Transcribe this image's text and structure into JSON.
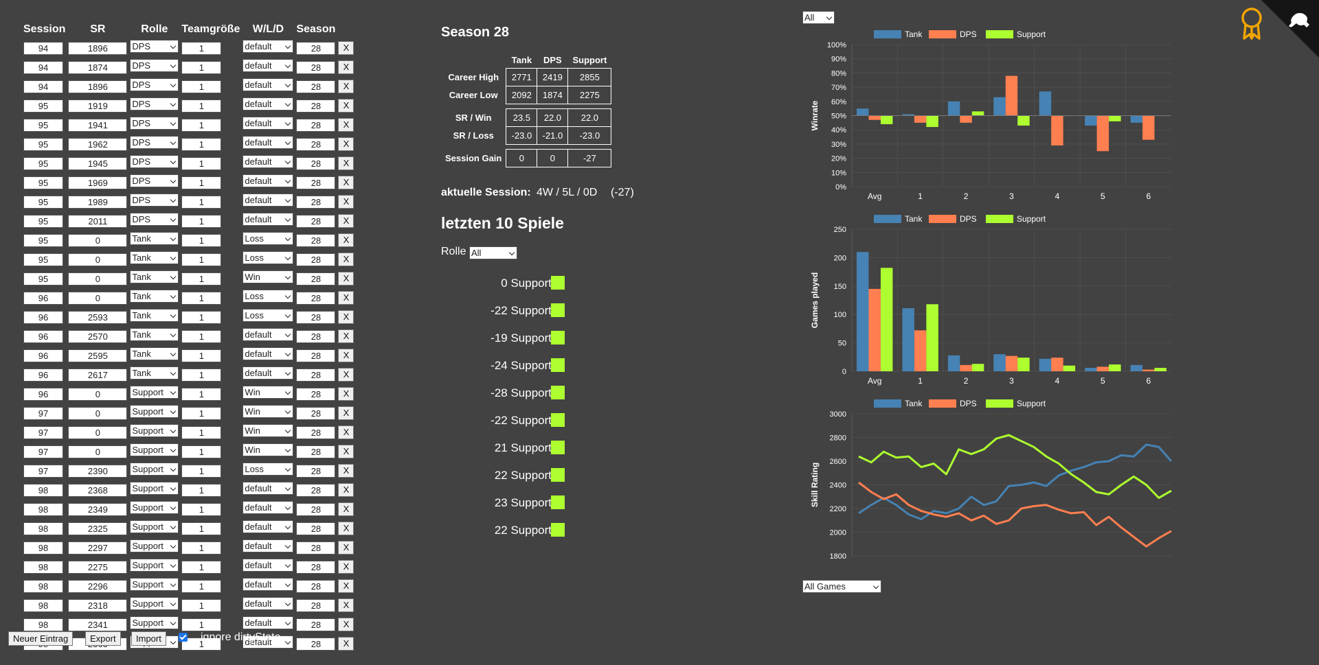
{
  "table": {
    "headers": [
      "Session",
      "SR",
      "Rolle",
      "Teamgröße",
      "W/L/D",
      "Season"
    ],
    "delete_label": "X",
    "rows": [
      {
        "session": "94",
        "sr": "1896",
        "role": "DPS",
        "team": "1",
        "wld": "default",
        "season": "28"
      },
      {
        "session": "94",
        "sr": "1874",
        "role": "DPS",
        "team": "1",
        "wld": "default",
        "season": "28"
      },
      {
        "session": "94",
        "sr": "1896",
        "role": "DPS",
        "team": "1",
        "wld": "default",
        "season": "28"
      },
      {
        "session": "95",
        "sr": "1919",
        "role": "DPS",
        "team": "1",
        "wld": "default",
        "season": "28"
      },
      {
        "session": "95",
        "sr": "1941",
        "role": "DPS",
        "team": "1",
        "wld": "default",
        "season": "28"
      },
      {
        "session": "95",
        "sr": "1962",
        "role": "DPS",
        "team": "1",
        "wld": "default",
        "season": "28"
      },
      {
        "session": "95",
        "sr": "1945",
        "role": "DPS",
        "team": "1",
        "wld": "default",
        "season": "28"
      },
      {
        "session": "95",
        "sr": "1969",
        "role": "DPS",
        "team": "1",
        "wld": "default",
        "season": "28"
      },
      {
        "session": "95",
        "sr": "1989",
        "role": "DPS",
        "team": "1",
        "wld": "default",
        "season": "28"
      },
      {
        "session": "95",
        "sr": "2011",
        "role": "DPS",
        "team": "1",
        "wld": "default",
        "season": "28"
      },
      {
        "session": "95",
        "sr": "0",
        "role": "Tank",
        "team": "1",
        "wld": "Loss",
        "season": "28"
      },
      {
        "session": "95",
        "sr": "0",
        "role": "Tank",
        "team": "1",
        "wld": "Loss",
        "season": "28"
      },
      {
        "session": "95",
        "sr": "0",
        "role": "Tank",
        "team": "1",
        "wld": "Win",
        "season": "28"
      },
      {
        "session": "96",
        "sr": "0",
        "role": "Tank",
        "team": "1",
        "wld": "Loss",
        "season": "28"
      },
      {
        "session": "96",
        "sr": "2593",
        "role": "Tank",
        "team": "1",
        "wld": "Loss",
        "season": "28"
      },
      {
        "session": "96",
        "sr": "2570",
        "role": "Tank",
        "team": "1",
        "wld": "default",
        "season": "28"
      },
      {
        "session": "96",
        "sr": "2595",
        "role": "Tank",
        "team": "1",
        "wld": "default",
        "season": "28"
      },
      {
        "session": "96",
        "sr": "2617",
        "role": "Tank",
        "team": "1",
        "wld": "default",
        "season": "28"
      },
      {
        "session": "96",
        "sr": "0",
        "role": "Support",
        "team": "1",
        "wld": "Win",
        "season": "28"
      },
      {
        "session": "97",
        "sr": "0",
        "role": "Support",
        "team": "1",
        "wld": "Win",
        "season": "28"
      },
      {
        "session": "97",
        "sr": "0",
        "role": "Support",
        "team": "1",
        "wld": "Win",
        "season": "28"
      },
      {
        "session": "97",
        "sr": "0",
        "role": "Support",
        "team": "1",
        "wld": "Win",
        "season": "28"
      },
      {
        "session": "97",
        "sr": "2390",
        "role": "Support",
        "team": "1",
        "wld": "Loss",
        "season": "28"
      },
      {
        "session": "98",
        "sr": "2368",
        "role": "Support",
        "team": "1",
        "wld": "default",
        "season": "28"
      },
      {
        "session": "98",
        "sr": "2349",
        "role": "Support",
        "team": "1",
        "wld": "default",
        "season": "28"
      },
      {
        "session": "98",
        "sr": "2325",
        "role": "Support",
        "team": "1",
        "wld": "default",
        "season": "28"
      },
      {
        "session": "98",
        "sr": "2297",
        "role": "Support",
        "team": "1",
        "wld": "default",
        "season": "28"
      },
      {
        "session": "98",
        "sr": "2275",
        "role": "Support",
        "team": "1",
        "wld": "default",
        "season": "28"
      },
      {
        "session": "98",
        "sr": "2296",
        "role": "Support",
        "team": "1",
        "wld": "default",
        "season": "28"
      },
      {
        "session": "98",
        "sr": "2318",
        "role": "Support",
        "team": "1",
        "wld": "default",
        "season": "28"
      },
      {
        "session": "98",
        "sr": "2341",
        "role": "Support",
        "team": "1",
        "wld": "default",
        "season": "28"
      },
      {
        "session": "98",
        "sr": "2363",
        "role": "Support",
        "team": "1",
        "wld": "default",
        "season": "28"
      }
    ]
  },
  "controls": {
    "new_entry": "Neuer Eintrag",
    "export": "Export",
    "import": "Import",
    "ignore_dirty": "ignore dirtyState",
    "ignore_dirty_checked": true
  },
  "stats": {
    "season_title": "Season 28",
    "columns": [
      "Tank",
      "DPS",
      "Support"
    ],
    "career_high_label": "Career High",
    "career_high": [
      "2771",
      "2419",
      "2855"
    ],
    "career_low_label": "Career Low",
    "career_low": [
      "2092",
      "1874",
      "2275"
    ],
    "sr_win_label": "SR / Win",
    "sr_win": [
      "23.5",
      "22.0",
      "22.0"
    ],
    "sr_loss_label": "SR / Loss",
    "sr_loss": [
      "-23.0",
      "-21.0",
      "-23.0"
    ],
    "session_gain_label": "Session Gain",
    "session_gain": [
      "0",
      "0",
      "-27"
    ],
    "current_session_label": "aktuelle Session:",
    "current_session_value": "4W / 5L / 0D",
    "current_session_gain": "(-27)"
  },
  "last_games": {
    "title": "letzten 10 Spiele",
    "role_label": "Rolle",
    "role_filter": "All",
    "square_color": "#adff2f",
    "items": [
      "0 Support",
      "-22 Support",
      "-19 Support",
      "-24 Support",
      "-28 Support",
      "-22 Support",
      "21 Support",
      "22 Support",
      "23 Support",
      "22 Support"
    ]
  },
  "filters": {
    "top": "All",
    "bottom": "All Games"
  },
  "colors": {
    "tank": "#4682b4",
    "dps": "#ff7f50",
    "support": "#adff2f",
    "background": "#424242"
  },
  "chart_data": [
    {
      "type": "bar",
      "ylabel": "Winrate",
      "ylim": [
        0,
        100
      ],
      "y_ticks": [
        "100%",
        "90%",
        "80%",
        "70%",
        "60%",
        "50%",
        "40%",
        "30%",
        "20%",
        "10%",
        "0%"
      ],
      "baseline": 50,
      "categories": [
        "Avg",
        "1",
        "2",
        "3",
        "4",
        "5",
        "6"
      ],
      "legend": "top",
      "series": [
        {
          "name": "Tank",
          "values": [
            55,
            51,
            60,
            63,
            67,
            43,
            45
          ]
        },
        {
          "name": "DPS",
          "values": [
            47,
            45,
            45,
            78,
            29,
            25,
            33
          ]
        },
        {
          "name": "Support",
          "values": [
            44,
            42,
            53,
            43,
            50,
            46,
            50
          ]
        }
      ]
    },
    {
      "type": "bar",
      "ylabel": "Games played",
      "ylim": [
        0,
        250
      ],
      "y_ticks": [
        "250",
        "200",
        "150",
        "100",
        "50",
        "0"
      ],
      "categories": [
        "Avg",
        "1",
        "2",
        "3",
        "4",
        "5",
        "6"
      ],
      "legend": "top",
      "series": [
        {
          "name": "Tank",
          "values": [
            210,
            111,
            28,
            30,
            22,
            6,
            11
          ]
        },
        {
          "name": "DPS",
          "values": [
            145,
            72,
            11,
            27,
            24,
            8,
            3
          ]
        },
        {
          "name": "Support",
          "values": [
            182,
            118,
            13,
            24,
            10,
            12,
            6
          ]
        }
      ]
    },
    {
      "type": "line",
      "ylabel": "Skill Rating",
      "ylim": [
        1800,
        3000
      ],
      "y_ticks": [
        "3000",
        "2800",
        "2600",
        "2400",
        "2200",
        "2000",
        "1800"
      ],
      "legend": "top",
      "x": [
        0,
        0.04,
        0.08,
        0.12,
        0.16,
        0.2,
        0.24,
        0.28,
        0.32,
        0.36,
        0.4,
        0.44,
        0.48,
        0.52,
        0.56,
        0.6,
        0.64,
        0.68,
        0.72,
        0.76,
        0.8,
        0.84,
        0.88,
        0.92,
        0.96,
        1.0
      ],
      "series": [
        {
          "name": "Tank",
          "values": [
            2160,
            2230,
            2290,
            2230,
            2150,
            2110,
            2180,
            2160,
            2200,
            2300,
            2230,
            2260,
            2390,
            2400,
            2420,
            2390,
            2480,
            2520,
            2550,
            2590,
            2600,
            2650,
            2640,
            2740,
            2720,
            2600
          ]
        },
        {
          "name": "DPS",
          "values": [
            2420,
            2340,
            2280,
            2320,
            2230,
            2180,
            2150,
            2130,
            2160,
            2100,
            2140,
            2070,
            2100,
            2200,
            2220,
            2230,
            2190,
            2160,
            2170,
            2060,
            2130,
            2040,
            1960,
            1880,
            1950,
            2010
          ]
        },
        {
          "name": "Support",
          "values": [
            2640,
            2590,
            2680,
            2630,
            2640,
            2550,
            2580,
            2490,
            2700,
            2660,
            2700,
            2790,
            2820,
            2770,
            2720,
            2640,
            2580,
            2490,
            2420,
            2340,
            2320,
            2400,
            2470,
            2400,
            2290,
            2350
          ]
        }
      ]
    }
  ]
}
